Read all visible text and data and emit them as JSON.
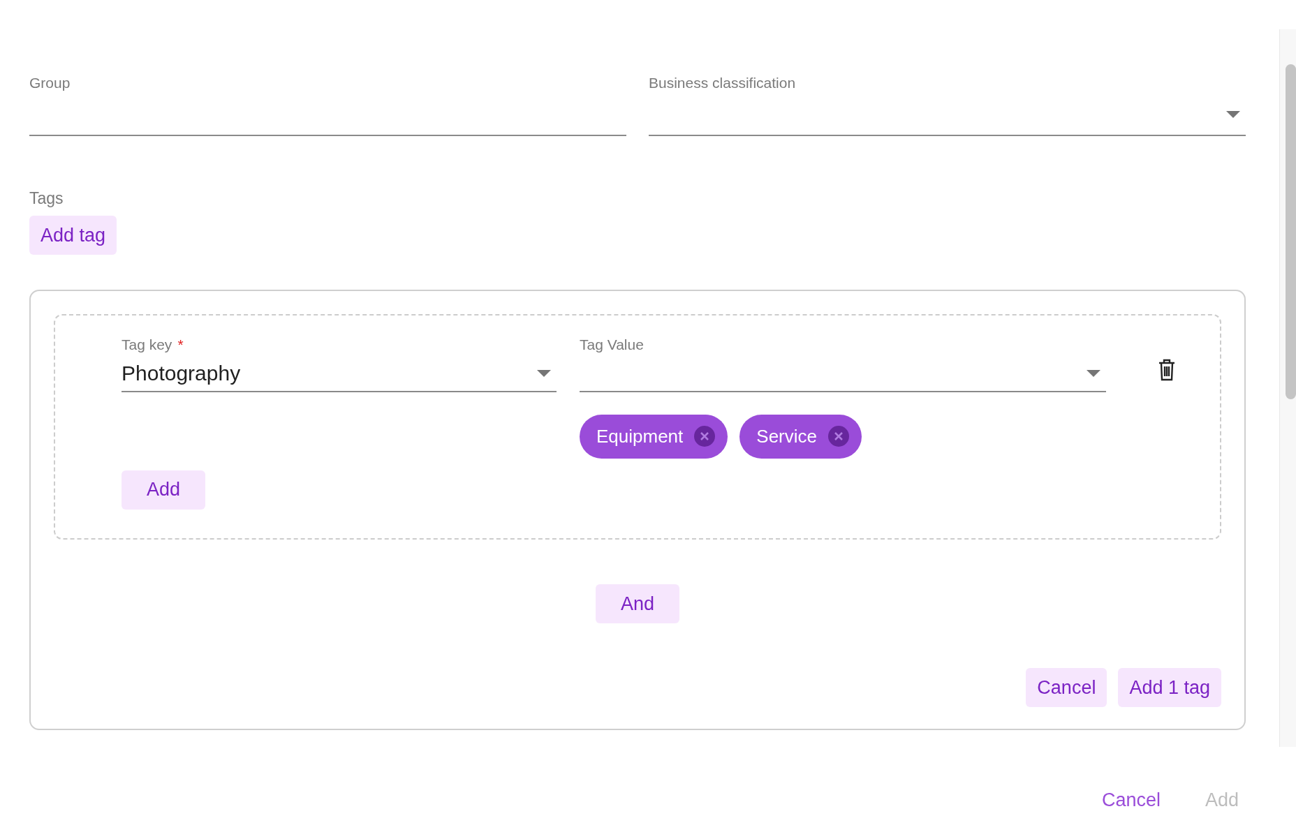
{
  "fields": [
    {
      "label": "Group",
      "dropdown": false
    },
    {
      "label": "Business classification",
      "dropdown": true
    }
  ],
  "tags": {
    "label": "Tags",
    "add_button": "Add tag"
  },
  "tag_panel": {
    "rule": {
      "key_field": {
        "label": "Tag key",
        "required_mark": "*",
        "value": "Photography"
      },
      "value_field": {
        "label": "Tag Value",
        "chips": [
          "Equipment",
          "Service"
        ]
      },
      "add_button": "Add"
    },
    "and_button": "And",
    "cancel_button": "Cancel",
    "confirm_button": "Add 1 tag"
  },
  "footer": [
    {
      "label": "Cancel",
      "disabled": false
    },
    {
      "label": "Add",
      "disabled": true
    }
  ]
}
